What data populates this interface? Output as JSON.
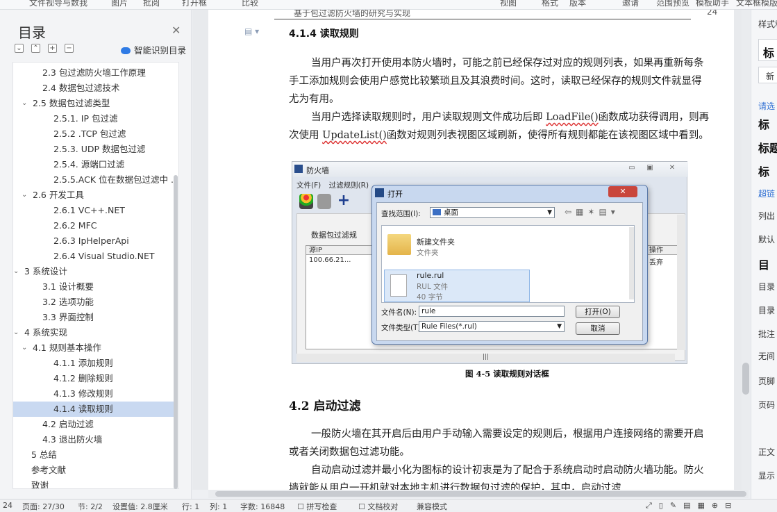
{
  "topbar": {
    "items": [
      "文件视导与数我",
      "图片",
      "批阅",
      "打开框",
      "比较",
      "视图",
      "格式",
      "版本",
      "邀请",
      "范围预览",
      "模板助手",
      "文本框模版"
    ]
  },
  "toc": {
    "title": "目录",
    "smart_label": "智能识别目录",
    "items": [
      {
        "label": "2.3  包过滤防火墙工作原理",
        "indent": 2,
        "chev": ""
      },
      {
        "label": "2.4  数据包过滤技术",
        "indent": 2,
        "chev": ""
      },
      {
        "label": "2.5  数据包过滤类型",
        "indent": 1,
        "chev": "v"
      },
      {
        "label": "2.5.1. IP 包过滤",
        "indent": 3,
        "chev": ""
      },
      {
        "label": "2.5.2 .TCP 包过滤",
        "indent": 3,
        "chev": ""
      },
      {
        "label": "2.5.3. UDP 数据包过滤",
        "indent": 3,
        "chev": ""
      },
      {
        "label": "2.5.4.  源端口过滤",
        "indent": 3,
        "chev": ""
      },
      {
        "label": "2.5.5.ACK 位在数据包过滤中 ...",
        "indent": 3,
        "chev": ""
      },
      {
        "label": "2.6 开发工具",
        "indent": 1,
        "chev": "v"
      },
      {
        "label": "2.6.1 VC++.NET",
        "indent": 3,
        "chev": ""
      },
      {
        "label": "2.6.2 MFC",
        "indent": 3,
        "chev": ""
      },
      {
        "label": "2.6.3 IpHelperApi",
        "indent": 3,
        "chev": ""
      },
      {
        "label": "2.6.4 Visual Studio.NET",
        "indent": 3,
        "chev": ""
      },
      {
        "label": "3  系统设计",
        "indent": 0,
        "chev": "v"
      },
      {
        "label": "3.1  设计概要",
        "indent": 2,
        "chev": ""
      },
      {
        "label": "3.2  选项功能",
        "indent": 2,
        "chev": ""
      },
      {
        "label": "3.3  界面控制",
        "indent": 2,
        "chev": ""
      },
      {
        "label": "4  系统实现",
        "indent": 0,
        "chev": "v"
      },
      {
        "label": "4.1  规则基本操作",
        "indent": 1,
        "chev": "v"
      },
      {
        "label": "4.1.1  添加规则",
        "indent": 3,
        "chev": ""
      },
      {
        "label": "4.1.2  删除规则",
        "indent": 3,
        "chev": ""
      },
      {
        "label": "4.1.3  修改规则",
        "indent": 3,
        "chev": ""
      },
      {
        "label": "4.1.4  读取规则",
        "indent": 3,
        "chev": "",
        "selected": true
      },
      {
        "label": "4.2  启动过滤",
        "indent": 2,
        "chev": ""
      },
      {
        "label": "4.3 退出防火墙",
        "indent": 2,
        "chev": ""
      },
      {
        "label": "5  总结",
        "indent": 4,
        "chev": ""
      },
      {
        "label": "参考文献",
        "indent": 4,
        "chev": ""
      },
      {
        "label": "致谢",
        "indent": 4,
        "chev": ""
      }
    ]
  },
  "doc": {
    "header_text": "基于包过滤防火墙的研究与实现",
    "page_number": "24",
    "heading_414": "4.1.4  读取规则",
    "para1": "当用户再次打开使用本防火墙时，可能之前已经保存过对应的规则列表，如果再重新每条手工添加规则会使用户感觉比较繁琐且及其浪费时间。这时，读取已经保存的规则文件就显得尤为有用。",
    "para2_a": "当用户选择读取规则时，用户读取规则文件成功后即 ",
    "para2_fn1": "LoadFile()",
    "para2_b": "函数成功获得调用，则再次使用 ",
    "para2_fn2": "UpdateList()",
    "para2_c": "函数对规则列表视图区域刷新，使得所有规则都能在该视图区域中看到。",
    "caption": "图 4-5  读取规则对话框",
    "heading_42": "4.2  启动过滤",
    "para3": "一般防火墙在其开启后由用户手动输入需要设定的规则后，根据用户连接网络的需要开启或者关闭数据包过滤功能。",
    "para4": "自动启动过滤并最小化为图标的设计初衷是为了配合于系统启动时启动防火墙功能。防火墙就能从用户一开机就对本地主机进行数据包过滤的保护，其中，启动过滤"
  },
  "figure": {
    "window_title": "防火墙",
    "menu": [
      "文件(F)",
      "过滤规则(R)"
    ],
    "pane_label": "数据包过滤规",
    "col_src": "源IP",
    "col_action": "操作",
    "row_src": "100.66.21...",
    "row_action": "丢弃",
    "dialog": {
      "title": "打开",
      "lookin_label": "查找范围(I):",
      "lookin_value": "桌面",
      "folder_name": "新建文件夹",
      "folder_type": "文件夹",
      "file_name": "rule.rul",
      "file_type": "RUL 文件",
      "file_size": "40 字节",
      "filename_label": "文件名(N):",
      "filename_value": "rule",
      "filetype_label": "文件类型(T):",
      "filetype_value": "Rule Files(*.rul)",
      "open_button": "打开(O)",
      "cancel_button": "取消"
    }
  },
  "right_panel": {
    "items": [
      "样式和",
      "标",
      "新",
      "请选",
      "标",
      "标题",
      "标",
      "超链",
      "列出",
      "默认",
      "目",
      "目录",
      "目录",
      "批注",
      "无间",
      "页脚",
      "页码",
      "正文",
      "显示"
    ]
  },
  "status": {
    "page": "页面: 27/30",
    "section": "节: 2/2",
    "setting": "设置值: 2.8厘米",
    "row": "行: 1",
    "col": "列: 1",
    "words": "字数: 16848",
    "spell": "拼写检查",
    "proof": "文档校对",
    "compat": "兼容模式",
    "left_num": "24"
  },
  "colors": {
    "selection": "#c9d9f1",
    "accent": "#2f6fd3"
  }
}
